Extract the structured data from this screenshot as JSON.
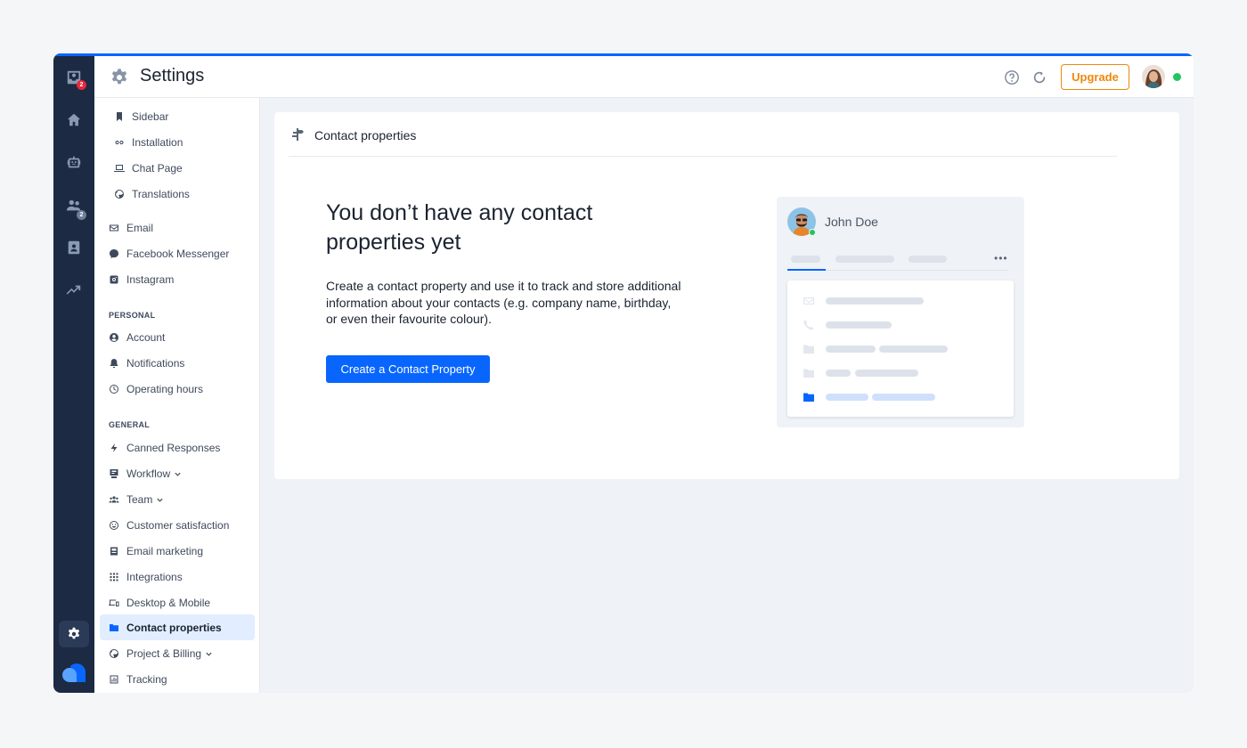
{
  "topbar": {
    "title": "Settings",
    "upgrade_label": "Upgrade",
    "icons": [
      "help-icon",
      "refresh-icon"
    ]
  },
  "rail": {
    "inbox_badge": "2",
    "contacts_badge": "2"
  },
  "nav": {
    "channels": [
      {
        "label": "Sidebar",
        "icon": "bookmark-icon"
      },
      {
        "label": "Installation",
        "icon": "link-icon"
      },
      {
        "label": "Chat Page",
        "icon": "laptop-icon"
      },
      {
        "label": "Translations",
        "icon": "globe-icon"
      }
    ],
    "integrations": [
      {
        "label": "Email",
        "icon": "mail-icon"
      },
      {
        "label": "Facebook Messenger",
        "icon": "messenger-icon"
      },
      {
        "label": "Instagram",
        "icon": "instagram-icon"
      }
    ],
    "personal_heading": "PERSONAL",
    "personal": [
      {
        "label": "Account",
        "icon": "user-circle-icon"
      },
      {
        "label": "Notifications",
        "icon": "bell-icon"
      },
      {
        "label": "Operating hours",
        "icon": "clock-icon"
      }
    ],
    "general_heading": "GENERAL",
    "general": [
      {
        "label": "Canned Responses",
        "icon": "bolt-icon"
      },
      {
        "label": "Workflow",
        "icon": "workflow-icon"
      },
      {
        "label": "Team",
        "icon": "team-icon"
      },
      {
        "label": "Customer satisfaction",
        "icon": "smile-icon"
      },
      {
        "label": "Email marketing",
        "icon": "newsletter-icon"
      },
      {
        "label": "Integrations",
        "icon": "grid-icon"
      },
      {
        "label": "Desktop & Mobile",
        "icon": "devices-icon"
      },
      {
        "label": "Contact properties",
        "icon": "folder-icon"
      },
      {
        "label": "Project & Billing",
        "icon": "globe-icon"
      },
      {
        "label": "Tracking",
        "icon": "chart-icon"
      }
    ]
  },
  "card": {
    "title": "Contact properties",
    "empty_title": "You don’t have any contact properties yet",
    "empty_desc": "Create a contact property and use it to track and store additional information about your contacts (e.g. company name, birthday, or even their favourite colour).",
    "cta_label": "Create a Contact Property",
    "illustration_name": "John Doe",
    "illustration_more": "•••"
  },
  "colors": {
    "accent": "#0866ff",
    "upgrade": "#f0870a",
    "rail": "#1c2a43",
    "online": "#23c45e",
    "badge": "#e5283a"
  }
}
